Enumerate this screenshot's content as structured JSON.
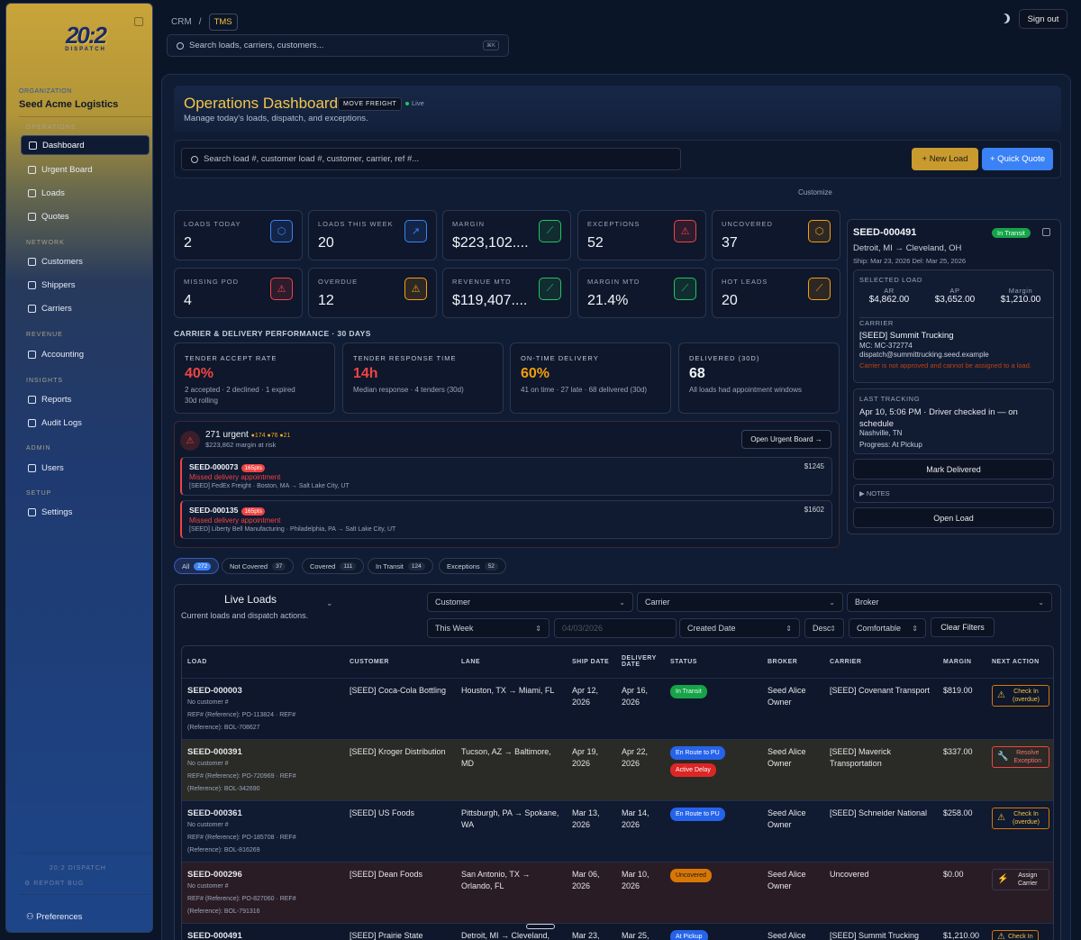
{
  "sidebar": {
    "logo_main": "20:2",
    "logo_sub": "DISPATCH",
    "org_label": "ORGANIZATION",
    "org_name": "Seed Acme Logistics",
    "sections": {
      "operations": "OPERATIONS",
      "network": "NETWORK",
      "revenue": "REVENUE",
      "insights": "INSIGHTS",
      "admin": "ADMIN",
      "setup": "SETUP"
    },
    "items": {
      "dashboard": "Dashboard",
      "urgent_board": "Urgent Board",
      "loads": "Loads",
      "quotes": "Quotes",
      "customers": "Customers",
      "shippers": "Shippers",
      "carriers": "Carriers",
      "accounting": "Accounting",
      "reports": "Reports",
      "audit_logs": "Audit Logs",
      "users": "Users",
      "settings": "Settings"
    },
    "footer_brand": "20:2 DISPATCH",
    "report_bug": "REPORT BUG",
    "preferences": "Preferences"
  },
  "topbar": {
    "crumb_crm": "CRM",
    "crumb_sep": "/",
    "crumb_tms": "TMS",
    "sign_out": "Sign out",
    "search_placeholder": "Search loads, carriers, customers...",
    "search_kbd": "⌘K"
  },
  "header": {
    "title": "Operations Dashboard",
    "badge": "MOVE FREIGHT",
    "live": "Live",
    "subtitle": "Manage today's loads, dispatch, and exceptions."
  },
  "actions": {
    "load_search_placeholder": "Search load #, customer load #, customer, carrier, ref #...",
    "new_load": "+ New Load",
    "quick_quote": "+ Quick Quote",
    "customize": "Customize"
  },
  "kpis": [
    {
      "label": "LOADS TODAY",
      "value": "2",
      "icon": "box-icon",
      "glyph": "⬡",
      "color": "#3b82f6"
    },
    {
      "label": "LOADS THIS WEEK",
      "value": "20",
      "icon": "arrow-up-right-icon",
      "glyph": "↗",
      "color": "#3b82f6"
    },
    {
      "label": "MARGIN",
      "value": "$223,102....",
      "icon": "trend-up-icon",
      "glyph": "⟋",
      "color": "#22c55e"
    },
    {
      "label": "EXCEPTIONS",
      "value": "52",
      "icon": "warning-icon",
      "glyph": "⚠",
      "color": "#ef4444"
    },
    {
      "label": "UNCOVERED",
      "value": "37",
      "icon": "box-icon",
      "glyph": "⬡",
      "color": "#f59e0b"
    },
    {
      "label": "MISSING POD",
      "value": "4",
      "icon": "warning-icon",
      "glyph": "⚠",
      "color": "#ef4444"
    },
    {
      "label": "OVERDUE",
      "value": "12",
      "icon": "warning-icon",
      "glyph": "⚠",
      "color": "#f59e0b"
    },
    {
      "label": "REVENUE MTD",
      "value": "$119,407....",
      "icon": "trend-up-icon",
      "glyph": "⟋",
      "color": "#22c55e"
    },
    {
      "label": "MARGIN MTD",
      "value": "21.4%",
      "icon": "trend-up-icon",
      "glyph": "⟋",
      "color": "#22c55e"
    },
    {
      "label": "HOT LEADS",
      "value": "20",
      "icon": "trend-up-icon",
      "glyph": "⟋",
      "color": "#f59e0b"
    }
  ],
  "performance": {
    "title": "CARRIER & DELIVERY PERFORMANCE · 30 DAYS",
    "cards": [
      {
        "label": "TENDER ACCEPT RATE",
        "value": "40%",
        "color": "#ef4444",
        "sub": "2 accepted · 2 declined · 1 expired",
        "sub2": "30d rolling"
      },
      {
        "label": "TENDER RESPONSE TIME",
        "value": "14h",
        "color": "#ef4444",
        "sub": "Median response · 4 tenders (30d)",
        "sub2": ""
      },
      {
        "label": "ON-TIME DELIVERY",
        "value": "60%",
        "color": "#f59e0b",
        "sub": "41 on time · 27 late · 68 delivered (30d)",
        "sub2": ""
      },
      {
        "label": "DELIVERED (30D)",
        "value": "68",
        "color": "#f1f5f9",
        "sub": "All loads had appointment windows",
        "sub2": ""
      }
    ]
  },
  "urgent": {
    "count_title": "271 urgent",
    "pts": "●174 ●76 ●21",
    "margin_risk": "$223,862 margin at risk",
    "open_board": "Open Urgent Board →",
    "rows": [
      {
        "id": "SEED-000073",
        "pts": "165pts",
        "reason": "Missed delivery appointment",
        "route": "[SEED] FedEx Freight · Boston, MA → Salt Lake City, UT",
        "amount": "$1245"
      },
      {
        "id": "SEED-000135",
        "pts": "165pts",
        "reason": "Missed delivery appointment",
        "route": "[SEED] Liberty Bell Manufacturing · Philadelphia, PA → Salt Lake City, UT",
        "amount": "$1602"
      }
    ]
  },
  "selected": {
    "id": "SEED-000491",
    "status": "In Transit",
    "route": "Detroit, MI → Cleveland, OH",
    "dates": "Ship: Mar 23, 2026   Del: Mar 25, 2026",
    "selected_label": "SELECTED LOAD",
    "ar_label": "AR",
    "ar": "$4,862.00",
    "ap_label": "AP",
    "ap": "$3,652.00",
    "margin_label": "Margin",
    "margin": "$1,210.00",
    "carrier_label": "CARRIER",
    "carrier_name": "[SEED] Summit Trucking",
    "carrier_mc": "MC: MC-372774",
    "carrier_email": "dispatch@summittrucking.seed.example",
    "carrier_warning": "Carrier is not approved and cannot be assigned to a load.",
    "tracking_label": "LAST TRACKING",
    "tracking_text": "Apr 10, 5:06 PM · Driver checked in — on schedule",
    "tracking_loc": "Nashville, TN",
    "tracking_progress": "Progress: At Pickup",
    "mark_delivered": "Mark Delivered",
    "notes": "▶ NOTES",
    "open_load": "Open Load"
  },
  "filters": [
    {
      "label": "All",
      "count": "272"
    },
    {
      "label": "Not Covered",
      "count": "37"
    },
    {
      "label": "Covered",
      "count": "111"
    },
    {
      "label": "In Transit",
      "count": "124"
    },
    {
      "label": "Exceptions",
      "count": "52"
    }
  ],
  "live_loads": {
    "title": "Live Loads",
    "subtitle": "Current loads and dispatch actions.",
    "customer": "Customer",
    "carrier": "Carrier",
    "broker": "Broker",
    "range": "This Week",
    "date_placeholder": "04/03/2026",
    "sort_field": "Created Date",
    "sort_dir": "Desc",
    "density": "Comfortable",
    "clear": "Clear Filters"
  },
  "table": {
    "headers": [
      "LOAD",
      "CUSTOMER",
      "LANE",
      "SHIP DATE",
      "DELIVERY DATE",
      "STATUS",
      "BROKER",
      "CARRIER",
      "MARGIN",
      "NEXT ACTION"
    ],
    "rows": [
      {
        "id": "SEED-000003",
        "cust_no": "No customer #",
        "ref1": "REF# (Reference): PO-113824 · REF#",
        "ref2": "(Reference): BOL-708627",
        "customer": "[SEED] Coca-Cola Bottling",
        "lane": "Houston, TX → Miami, FL",
        "ship": "Apr 12, 2026",
        "deliv": "Apr 16, 2026",
        "status": [
          "In Transit"
        ],
        "status_cls": [
          "green"
        ],
        "broker": "Seed Alice Owner",
        "carrier": "[SEED] Covenant Transport",
        "margin": "$819.00",
        "action": "Check In (overdue)",
        "action_icon": "⚠",
        "action_cls": ""
      },
      {
        "id": "SEED-000391",
        "cust_no": "No customer #",
        "ref1": "REF# (Reference): PO-720969 · REF#",
        "ref2": "(Reference): BOL-342690",
        "customer": "[SEED] Kroger Distribution",
        "lane": "Tucson, AZ → Baltimore, MD",
        "ship": "Apr 19, 2026",
        "deliv": "Apr 22, 2026",
        "status": [
          "En Route to PU",
          "Active Delay"
        ],
        "status_cls": [
          "blue",
          "red"
        ],
        "broker": "Seed Alice Owner",
        "carrier": "[SEED] Maverick Transportation",
        "margin": "$337.00",
        "action": "Resolve Exception",
        "action_icon": "🔧",
        "action_cls": "red"
      },
      {
        "id": "SEED-000361",
        "cust_no": "No customer #",
        "ref1": "REF# (Reference): PO-185708 · REF#",
        "ref2": "(Reference): BOL-816269",
        "customer": "[SEED] US Foods",
        "lane": "Pittsburgh, PA → Spokane, WA",
        "ship": "Mar 13, 2026",
        "deliv": "Mar 14, 2026",
        "status": [
          "En Route to PU"
        ],
        "status_cls": [
          "blue"
        ],
        "broker": "Seed Alice Owner",
        "carrier": "[SEED] Schneider National",
        "margin": "$258.00",
        "action": "Check In (overdue)",
        "action_icon": "⚠",
        "action_cls": ""
      },
      {
        "id": "SEED-000296",
        "cust_no": "No customer #",
        "ref1": "REF# (Reference): PO-827060 · REF#",
        "ref2": "(Reference): BOL-791316",
        "customer": "[SEED] Dean Foods",
        "lane": "San Antonio, TX → Orlando, FL",
        "ship": "Mar 06, 2026",
        "deliv": "Mar 10, 2026",
        "status": [
          "Uncovered"
        ],
        "status_cls": [
          "amber"
        ],
        "broker": "Seed Alice Owner",
        "carrier": "Uncovered",
        "margin": "$0.00",
        "action": "Assign Carrier",
        "action_icon": "⚡",
        "action_cls": "wht"
      },
      {
        "id": "SEED-000491",
        "cust_no": "",
        "ref1": "",
        "ref2": "",
        "customer": "[SEED] Prairie State",
        "lane": "Detroit, MI → Cleveland,",
        "ship": "Mar 23,",
        "deliv": "Mar 25,",
        "status": [
          "At Pickup"
        ],
        "status_cls": [
          "blue"
        ],
        "broker": "Seed Alice",
        "carrier": "[SEED] Summit Trucking",
        "margin": "$1,210.00",
        "action": "Check In",
        "action_icon": "⚠",
        "action_cls": ""
      }
    ]
  }
}
